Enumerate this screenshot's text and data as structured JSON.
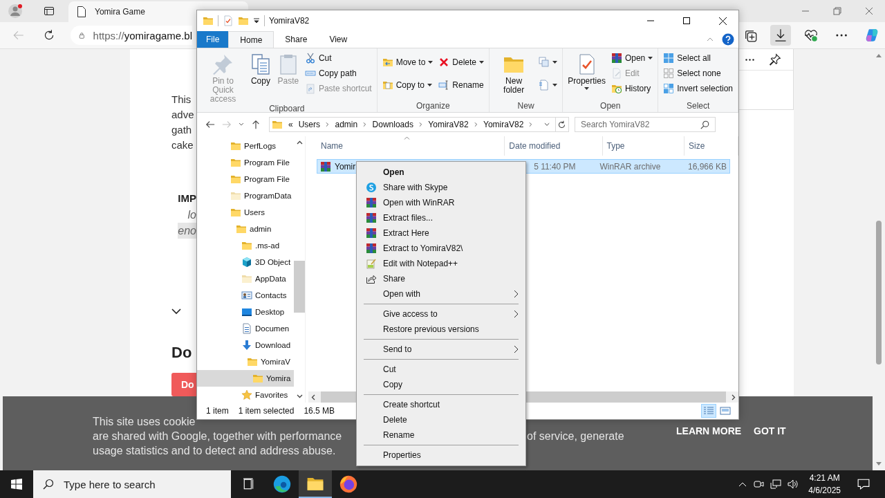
{
  "browser": {
    "tab": {
      "title": "Yomira Game"
    },
    "url": {
      "scheme": "https://",
      "host": "yomiragame.bl"
    },
    "toolbar": [
      {
        "kind": "collections",
        "selected": false
      },
      {
        "kind": "downloads",
        "selected": true
      },
      {
        "kind": "health",
        "selected": false
      },
      {
        "kind": "more",
        "selected": false
      },
      {
        "kind": "copilot",
        "selected": false
      }
    ]
  },
  "page": {
    "paragraph": [
      "This",
      "adve",
      "gath",
      "cake"
    ],
    "important": {
      "heading": "IMP",
      "lines": [
        "lo",
        "eno"
      ]
    },
    "download_heading": "Do",
    "download_button": "Do"
  },
  "cookie_bar": {
    "lines": [
      {
        "left": "This site uses cookie"
      },
      {
        "left": "are shared with Google, together with performance",
        "right": "of service, generate"
      },
      {
        "left": "usage statistics and to detect and address abuse."
      }
    ],
    "learn_more": "LEARN MORE",
    "got_it": "GOT IT"
  },
  "explorer": {
    "title": "YomiraV82",
    "ribbon": {
      "tabs": [
        {
          "label": "File",
          "kind": "file",
          "selected": false
        },
        {
          "label": "Home",
          "kind": "tab",
          "selected": true
        },
        {
          "label": "Share",
          "kind": "tab",
          "selected": false
        },
        {
          "label": "View",
          "kind": "tab",
          "selected": false
        }
      ],
      "groups": [
        {
          "label": "Clipboard",
          "columns": [
            [
              {
                "label": "Pin to Quick access",
                "kind": "pin",
                "large": true,
                "disabled": true,
                "dropdown": false
              }
            ],
            [
              {
                "label": "Copy",
                "kind": "copy",
                "large": true,
                "disabled": false,
                "dropdown": false
              }
            ],
            [
              {
                "label": "Paste",
                "kind": "paste",
                "large": true,
                "disabled": true,
                "dropdown": false
              }
            ],
            [
              {
                "label": "Cut",
                "kind": "cut",
                "large": false,
                "disabled": false,
                "dropdown": false
              },
              {
                "label": "Copy path",
                "kind": "copy-path",
                "large": false,
                "disabled": false,
                "dropdown": false
              },
              {
                "label": "Paste shortcut",
                "kind": "paste-shortcut",
                "large": false,
                "disabled": true,
                "dropdown": false
              }
            ]
          ]
        },
        {
          "label": "Organize",
          "columns": [
            [
              {
                "label": "Move to",
                "kind": "move-to",
                "large": false,
                "disabled": false,
                "dropdown": true
              },
              {
                "label": "Copy to",
                "kind": "copy-to",
                "large": false,
                "disabled": false,
                "dropdown": true
              }
            ],
            [
              {
                "label": "Delete",
                "kind": "delete",
                "large": false,
                "disabled": false,
                "dropdown": true
              },
              {
                "label": "Rename",
                "kind": "rename",
                "large": false,
                "disabled": false,
                "dropdown": false
              }
            ]
          ]
        },
        {
          "label": "New",
          "columns": [
            [
              {
                "label": "New folder",
                "kind": "new-folder",
                "large": true,
                "disabled": false,
                "dropdown": false
              }
            ],
            [
              {
                "kind": "new-item",
                "large": false,
                "disabled": false,
                "dropdown": true
              },
              {
                "kind": "easy-access",
                "large": false,
                "disabled": false,
                "dropdown": true
              }
            ]
          ]
        },
        {
          "label": "Open",
          "columns": [
            [
              {
                "label": "Properties",
                "kind": "properties",
                "large": true,
                "disabled": false,
                "dropdown": true
              }
            ],
            [
              {
                "label": "Open",
                "kind": "winrar",
                "large": false,
                "disabled": false,
                "dropdown": true
              },
              {
                "label": "Edit",
                "kind": "edit",
                "large": false,
                "disabled": true,
                "dropdown": false
              },
              {
                "label": "History",
                "kind": "history",
                "large": false,
                "disabled": false,
                "dropdown": false
              }
            ]
          ]
        },
        {
          "label": "Select",
          "columns": [
            [
              {
                "label": "Select all",
                "kind": "select-all",
                "large": false,
                "disabled": false,
                "dropdown": false
              },
              {
                "label": "Select none",
                "kind": "select-none",
                "large": false,
                "disabled": false,
                "dropdown": false
              },
              {
                "label": "Invert selection",
                "kind": "invert",
                "large": false,
                "disabled": false,
                "dropdown": false
              }
            ]
          ]
        }
      ]
    },
    "address": {
      "overflow": "«",
      "crumbs": [
        "Users",
        "admin",
        "Downloads",
        "YomiraV82",
        "YomiraV82"
      ]
    },
    "search": {
      "placeholder": "Search YomiraV82"
    },
    "nav": [
      {
        "label": "PerfLogs",
        "kind": "folder",
        "selected": false
      },
      {
        "label": "Program File",
        "kind": "folder",
        "selected": false
      },
      {
        "label": "Program File",
        "kind": "folder",
        "selected": false
      },
      {
        "label": "ProgramData",
        "kind": "hidden-folder",
        "selected": false
      },
      {
        "label": "Users",
        "kind": "folder",
        "selected": false,
        "children": [
          {
            "label": "admin",
            "kind": "folder",
            "selected": false,
            "children": [
              {
                "label": ".ms-ad",
                "kind": "folder",
                "selected": false
              },
              {
                "label": "3D Object",
                "kind": "cube",
                "selected": false
              },
              {
                "label": "AppData",
                "kind": "hidden-folder",
                "selected": false
              },
              {
                "label": "Contacts",
                "kind": "contacts",
                "selected": false
              },
              {
                "label": "Desktop",
                "kind": "desktop",
                "selected": false
              },
              {
                "label": "Documen",
                "kind": "documents",
                "selected": false
              },
              {
                "label": "Download",
                "kind": "download",
                "selected": false,
                "children": [
                  {
                    "label": "YomiraV",
                    "kind": "folder",
                    "selected": false,
                    "children": [
                      {
                        "label": "Yomira",
                        "kind": "folder",
                        "selected": true
                      }
                    ]
                  }
                ]
              },
              {
                "label": "Favorites",
                "kind": "star",
                "selected": false
              }
            ]
          }
        ]
      }
    ],
    "columns": [
      "Name",
      "Date modified",
      "Type",
      "Size"
    ],
    "rows": [
      {
        "name": "Yomir",
        "date": "5 11:40 PM",
        "type": "WinRAR archive",
        "size": "16,966 KB",
        "selected": true
      }
    ],
    "status": {
      "count": "1 item",
      "selection": "1 item selected",
      "size": "16.5 MB"
    }
  },
  "context_menu": {
    "groups": [
      [
        {
          "label": "Open",
          "kind": "none",
          "submenu": false,
          "default": true
        },
        {
          "label": "Share with Skype",
          "kind": "skype",
          "submenu": false,
          "default": false
        },
        {
          "label": "Open with WinRAR",
          "kind": "winrar",
          "submenu": false,
          "default": false
        },
        {
          "label": "Extract files...",
          "kind": "winrar",
          "submenu": false,
          "default": false
        },
        {
          "label": "Extract Here",
          "kind": "winrar",
          "submenu": false,
          "default": false
        },
        {
          "label": "Extract to YomiraV82\\",
          "kind": "winrar",
          "submenu": false,
          "default": false
        },
        {
          "label": "Edit with Notepad++",
          "kind": "notepad",
          "submenu": false,
          "default": false
        },
        {
          "label": "Share",
          "kind": "share",
          "submenu": false,
          "default": false
        },
        {
          "label": "Open with",
          "kind": "none",
          "submenu": true,
          "default": false
        }
      ],
      [
        {
          "label": "Give access to",
          "kind": "none",
          "submenu": true,
          "default": false
        },
        {
          "label": "Restore previous versions",
          "kind": "none",
          "submenu": false,
          "default": false
        }
      ],
      [
        {
          "label": "Send to",
          "kind": "none",
          "submenu": true,
          "default": false
        }
      ],
      [
        {
          "label": "Cut",
          "kind": "none",
          "submenu": false,
          "default": false
        },
        {
          "label": "Copy",
          "kind": "none",
          "submenu": false,
          "default": false
        }
      ],
      [
        {
          "label": "Create shortcut",
          "kind": "none",
          "submenu": false,
          "default": false
        },
        {
          "label": "Delete",
          "kind": "none",
          "submenu": false,
          "default": false
        },
        {
          "label": "Rename",
          "kind": "none",
          "submenu": false,
          "default": false
        }
      ],
      [
        {
          "label": "Properties",
          "kind": "none",
          "submenu": false,
          "default": false
        }
      ]
    ]
  },
  "taskbar": {
    "search": {
      "placeholder": "Type here to search"
    },
    "apps": [
      {
        "kind": "task-view",
        "selected": false
      },
      {
        "kind": "edge",
        "selected": false
      },
      {
        "kind": "explorer",
        "selected": true
      },
      {
        "kind": "firefox",
        "selected": false
      }
    ],
    "clock": {
      "time": "4:21 AM",
      "date": "4/6/2025"
    }
  }
}
